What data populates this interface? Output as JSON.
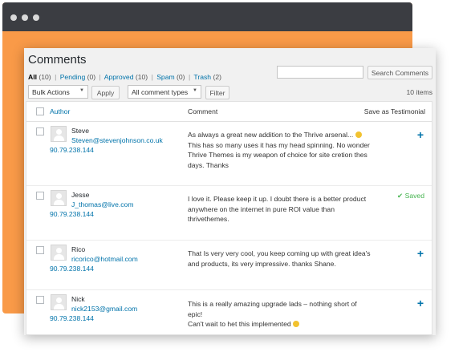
{
  "page": {
    "title": "Comments",
    "filters": [
      {
        "label": "All",
        "count": "(10)"
      },
      {
        "label": "Pending",
        "count": "(0)"
      },
      {
        "label": "Approved",
        "count": "(10)"
      },
      {
        "label": "Spam",
        "count": "(0)"
      },
      {
        "label": "Trash",
        "count": "(2)"
      }
    ],
    "filter_separator": "|",
    "search_button": "Search Comments",
    "bulk_actions": "Bulk Actions",
    "apply_button": "Apply",
    "comment_types": "All comment types",
    "filter_button": "Filter",
    "items_count": "10 items"
  },
  "table": {
    "headers": {
      "author": "Author",
      "comment": "Comment",
      "save": "Save as Testimonial"
    },
    "rows": [
      {
        "name": "Steve",
        "email": "Steven@stevenjohnson.co.uk",
        "ip": "90.79.238.144",
        "comment_lines": [
          "As always a great new addition to the Thrive arsenal...",
          "This has so many uses it has my head spinning. No wonder",
          "Thrive Themes is my weapon of choice for site cretion thes",
          "days. Thanks"
        ],
        "action": "add"
      },
      {
        "name": "Jesse",
        "email": "J_thomas@live.com",
        "ip": "90.79.238.144",
        "comment_lines": [
          "I love it. Please keep it up. I doubt there is a better product",
          "anywhere on the internet in pure ROI value than",
          "thrivethemes."
        ],
        "action": "saved",
        "saved_label": "Saved"
      },
      {
        "name": "Rico",
        "email": "ricorico@hotmail.com",
        "ip": "90.79.238.144",
        "comment_lines": [
          "That Is very very cool, you keep coming up with great idea's",
          "and products, its very impressive. thanks Shane."
        ],
        "action": "add"
      },
      {
        "name": "Nick",
        "email": "nick2153@gmail.com",
        "ip": "90.79.238.144",
        "comment_lines": [
          "This is a really amazing upgrade lads – nothing short of",
          "epic!",
          "Can't wait to het this implemented"
        ],
        "action": "add"
      }
    ]
  },
  "colors": {
    "frame_background": "#f99a48",
    "titlebar": "#3b3d42",
    "link": "#0073aa",
    "saved": "#46b450"
  }
}
